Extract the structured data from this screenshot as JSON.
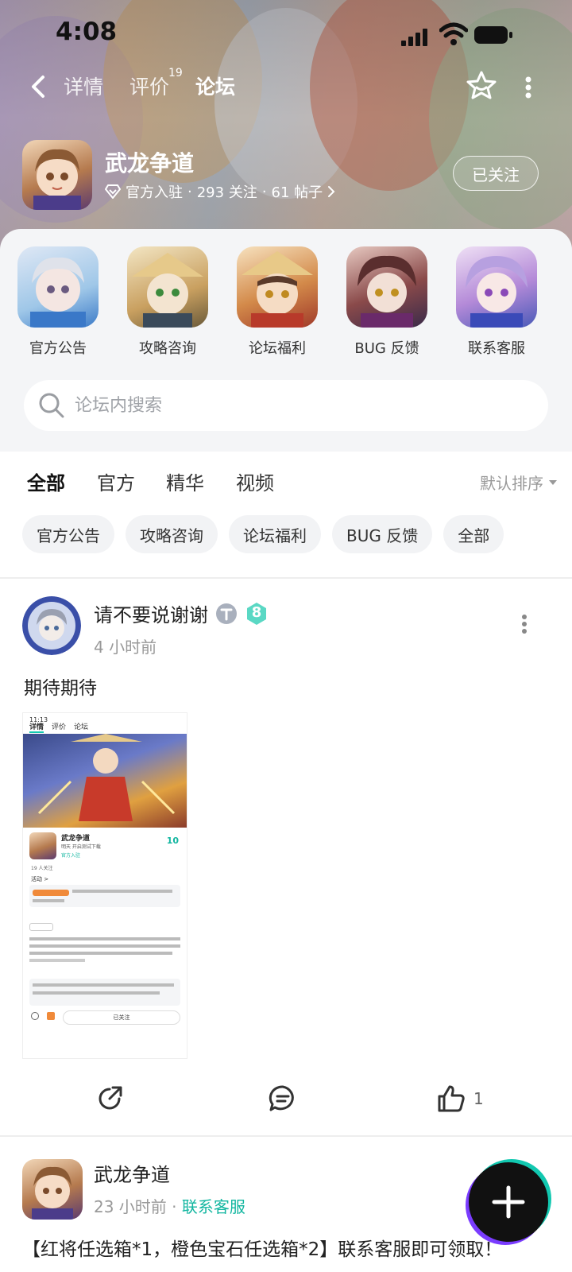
{
  "status": {
    "time": "4:08"
  },
  "nav": {
    "tabs": [
      {
        "label": "详情"
      },
      {
        "label": "评价",
        "badge": "19"
      },
      {
        "label": "论坛"
      }
    ],
    "active_tab": "论坛"
  },
  "game": {
    "name": "武龙争道",
    "official": "官方入驻",
    "followers": "293 关注",
    "posts": "61 帖子",
    "follow_label": "已关注"
  },
  "entries": [
    {
      "label": "官方公告"
    },
    {
      "label": "攻略咨询"
    },
    {
      "label": "论坛福利"
    },
    {
      "label": "BUG 反馈"
    },
    {
      "label": "联系客服"
    }
  ],
  "search": {
    "placeholder": "论坛内搜索"
  },
  "feed": {
    "tabs": [
      "全部",
      "官方",
      "精华",
      "视频"
    ],
    "sort_label": "默认排序",
    "chips": [
      "官方公告",
      "攻略咨询",
      "论坛福利",
      "BUG 反馈",
      "全部"
    ]
  },
  "post1": {
    "user": "请不要说谢谢",
    "level": "8",
    "time": "4 小时前",
    "text": "期待期待",
    "likes": "1",
    "shot": {
      "time": "11:13",
      "tabs": [
        "详情",
        "评价",
        "论坛"
      ],
      "title": "武龙争道",
      "sub": "明天 开启测试下载",
      "official": "官方入驻",
      "score": "10",
      "fans": "19 人关注",
      "activity": "活动 >",
      "follow": "已关注"
    }
  },
  "post2": {
    "user": "武龙争道",
    "time": "23 小时前",
    "tag": "联系客服",
    "text": "【红将任选箱*1，橙色宝石任选箱*2】联系客服即可领取！"
  },
  "colors": {
    "accent": "#12c8b0",
    "tag": "#12b6a0"
  }
}
